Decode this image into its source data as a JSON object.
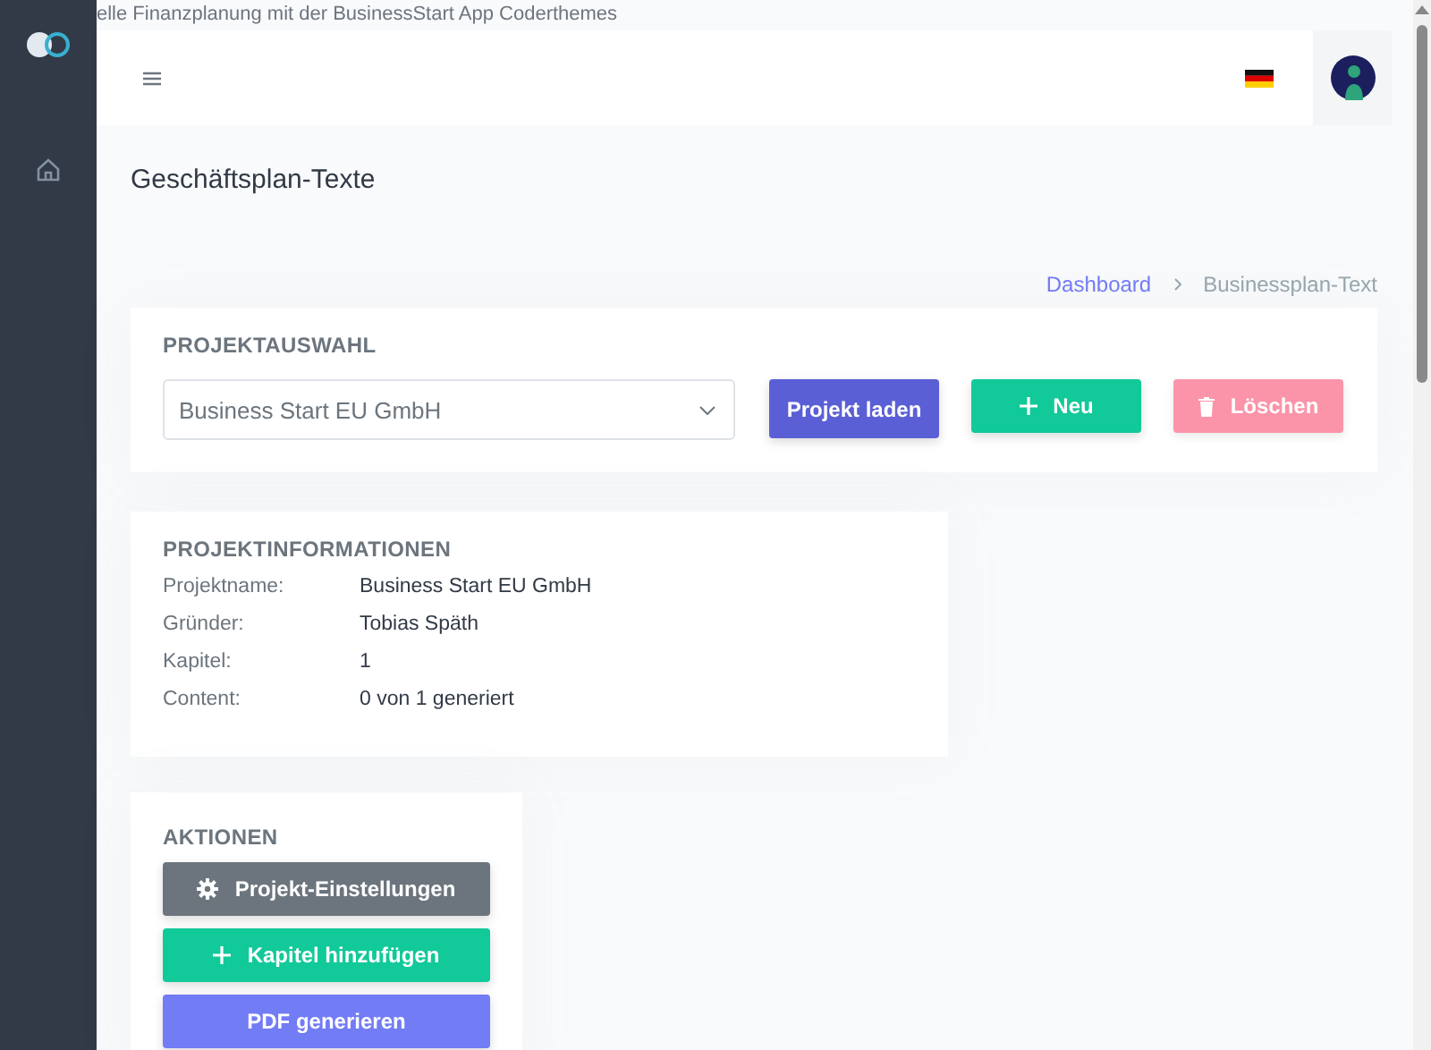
{
  "window": {
    "title": "elle Finanzplanung mit der BusinessStart App Coderthemes"
  },
  "page_title": "Geschäftsplan-Texte",
  "breadcrumb": [
    {
      "label": "Dashboard",
      "kind": "link"
    },
    {
      "label": "Businessplan-Text",
      "kind": "current"
    }
  ],
  "project_selection": {
    "heading": "PROJEKTAUSWAHL",
    "select": {
      "value": "Business Start EU GmbH"
    },
    "buttons": [
      {
        "label": "Projekt laden",
        "kind": "load",
        "disabled": false
      },
      {
        "label": "Neu",
        "kind": "new",
        "disabled": false
      },
      {
        "label": "Löschen",
        "kind": "delete",
        "disabled": true
      }
    ]
  },
  "project_info": {
    "heading": "PROJEKTINFORMATIONEN",
    "rows": [
      {
        "label": "Projektname:",
        "value": "Business Start EU GmbH"
      },
      {
        "label": "Gründer:",
        "value": "Tobias Späth"
      },
      {
        "label": "Kapitel:",
        "value": "1"
      },
      {
        "label": "Content:",
        "value": "0 von 1 generiert"
      }
    ]
  },
  "actions": {
    "heading": "AKTIONEN",
    "buttons": [
      {
        "label": "Projekt-Einstellungen",
        "kind": "settings"
      },
      {
        "label": "Kapitel hinzufügen",
        "kind": "add"
      },
      {
        "label": "PDF generieren",
        "kind": "pdf"
      }
    ]
  }
}
